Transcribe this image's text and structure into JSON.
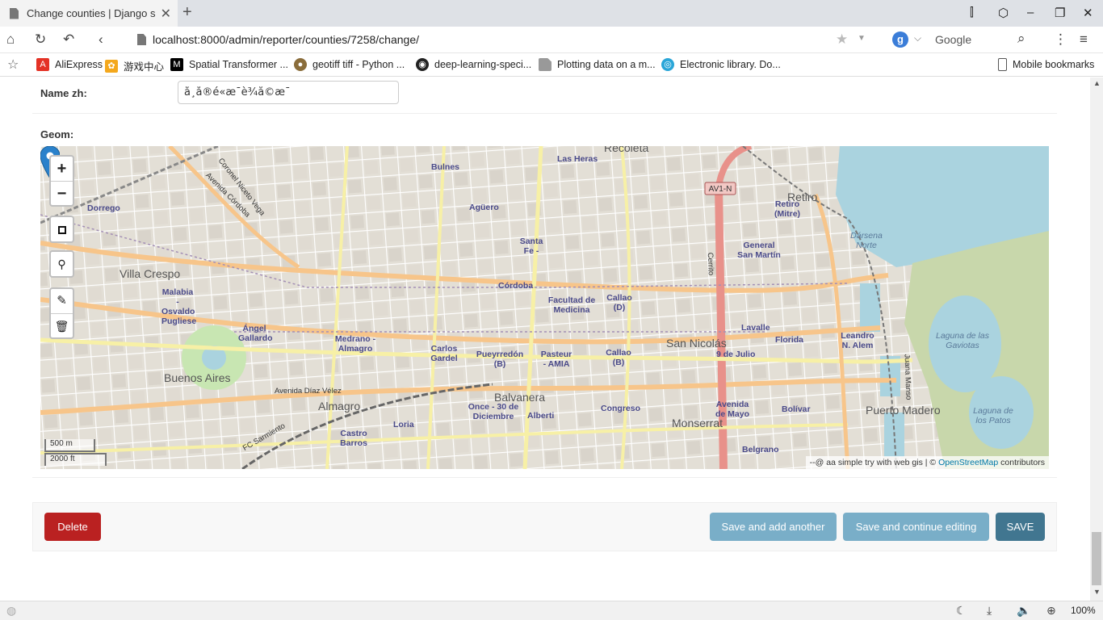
{
  "browser": {
    "tab_title": "Change counties | Django site admin",
    "url": "localhost:8000/admin/reporter/counties/7258/change/",
    "search_engine": "Google",
    "zoom": "100%",
    "bookmarks": [
      {
        "label": "AliExpress",
        "icon": "aliexpress-icon",
        "color": "#e43225"
      },
      {
        "label": "游戏中心",
        "icon": "game-center-icon",
        "color": "#f4a81d"
      },
      {
        "label": "Spatial Transformer ...",
        "icon": "medium-icon",
        "color": "#000000"
      },
      {
        "label": "geotiff tiff - Python ...",
        "icon": "stackexchange-icon",
        "color": "#8a6d3b"
      },
      {
        "label": "deep-learning-speci...",
        "icon": "github-icon",
        "color": "#222222"
      },
      {
        "label": "Plotting data on a m...",
        "icon": "page-icon",
        "color": "#888888"
      },
      {
        "label": "Electronic library. Do...",
        "icon": "library-icon",
        "color": "#2aa6d8"
      }
    ],
    "mobile_bookmarks": "Mobile bookmarks"
  },
  "form": {
    "name_zh_label": "Name zh:",
    "name_zh_value": "å¸å®é«æ¯è¾å©æ¯",
    "geom_label": "Geom:"
  },
  "map": {
    "zoom_in": "+",
    "zoom_out": "−",
    "scale_metric": "500 m",
    "scale_imperial": "2000 ft",
    "attribution_prefix": "--@ aa simple try with web gis | © ",
    "attribution_link": "OpenStreetMap",
    "attribution_suffix": " contributors",
    "route_badge": "AV1-N",
    "places": [
      {
        "text": "Recoleta",
        "kind": "big"
      },
      {
        "text": "Las Heras",
        "kind": "station"
      },
      {
        "text": "Bulnes",
        "kind": "station"
      },
      {
        "text": "Agüero",
        "kind": "station"
      },
      {
        "text": "Dorrego",
        "kind": "station"
      },
      {
        "text": "Villa Crespo",
        "kind": "big"
      },
      {
        "text": "Malabia - Osvaldo Pugliese",
        "kind": "station"
      },
      {
        "text": "Santa Fe - Carlos Jauregui",
        "kind": "station"
      },
      {
        "text": "Córdoba",
        "kind": "station"
      },
      {
        "text": "Facultad de Medicina",
        "kind": "station"
      },
      {
        "text": "Callao (D)",
        "kind": "station"
      },
      {
        "text": "Retiro (Mitre)",
        "kind": "station"
      },
      {
        "text": "Retiro",
        "kind": "big"
      },
      {
        "text": "General San Martín",
        "kind": "station"
      },
      {
        "text": "Dársena Norte",
        "kind": "water"
      },
      {
        "text": "Ángel Gallardo",
        "kind": "station"
      },
      {
        "text": "Medrano - Almagro",
        "kind": "station"
      },
      {
        "text": "Carlos Gardel",
        "kind": "station"
      },
      {
        "text": "Pueyrredón (B)",
        "kind": "station"
      },
      {
        "text": "Pasteur - AMIA",
        "kind": "station"
      },
      {
        "text": "Callao (B)",
        "kind": "station"
      },
      {
        "text": "San Nicolás",
        "kind": "big"
      },
      {
        "text": "Lavalle",
        "kind": "station"
      },
      {
        "text": "Florida",
        "kind": "station"
      },
      {
        "text": "Leandro N. Alem",
        "kind": "station"
      },
      {
        "text": "9 de Julio",
        "kind": "station"
      },
      {
        "text": "Buenos Aires",
        "kind": "big"
      },
      {
        "text": "Almagro",
        "kind": "big"
      },
      {
        "text": "Balvanera",
        "kind": "big"
      },
      {
        "text": "Once - 30 de Diciembre",
        "kind": "station"
      },
      {
        "text": "Alberti",
        "kind": "station"
      },
      {
        "text": "Congreso",
        "kind": "station"
      },
      {
        "text": "Avenida de Mayo",
        "kind": "station"
      },
      {
        "text": "Bolívar",
        "kind": "station"
      },
      {
        "text": "Puerto Madero",
        "kind": "big"
      },
      {
        "text": "Monserrat",
        "kind": "big"
      },
      {
        "text": "Loria",
        "kind": "station"
      },
      {
        "text": "Castro Barros",
        "kind": "station"
      },
      {
        "text": "Belgrano",
        "kind": "station"
      },
      {
        "text": "Laguna de las Gaviotas",
        "kind": "water"
      },
      {
        "text": "Laguna de los Patos",
        "kind": "water"
      },
      {
        "text": "Avenida Díaz Vélez",
        "kind": "street"
      },
      {
        "text": "Coronel Niceto Vega",
        "kind": "street"
      },
      {
        "text": "Avenida Córdoba",
        "kind": "street"
      },
      {
        "text": "FC Sarmiento",
        "kind": "street"
      },
      {
        "text": "Cerrito",
        "kind": "street"
      },
      {
        "text": "Juana Manso",
        "kind": "street"
      }
    ]
  },
  "buttons": {
    "delete": "Delete",
    "save_add_another": "Save and add another",
    "save_continue": "Save and continue editing",
    "save": "SAVE"
  }
}
